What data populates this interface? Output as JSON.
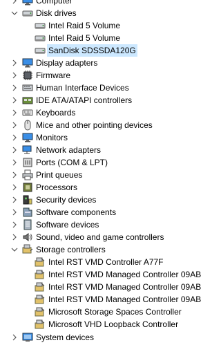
{
  "tree": {
    "computer": {
      "label": "Computer"
    },
    "disk_drives": {
      "label": "Disk drives",
      "children": [
        "Intel Raid 5 Volume",
        "Intel Raid 5 Volume",
        "SanDisk SDSSDA120G"
      ]
    },
    "categories_a": [
      {
        "label": "Display adapters",
        "icon": "monitor-icon"
      },
      {
        "label": "Firmware",
        "icon": "chip-icon"
      },
      {
        "label": "Human Interface Devices",
        "icon": "hid-icon"
      },
      {
        "label": "IDE ATA/ATAPI controllers",
        "icon": "ide-controller-icon"
      },
      {
        "label": "Keyboards",
        "icon": "keyboard-icon"
      },
      {
        "label": "Mice and other pointing devices",
        "icon": "mouse-icon"
      },
      {
        "label": "Monitors",
        "icon": "monitor-icon"
      },
      {
        "label": "Network adapters",
        "icon": "network-adapter-icon"
      },
      {
        "label": "Ports (COM & LPT)",
        "icon": "port-icon"
      },
      {
        "label": "Print queues",
        "icon": "printer-icon"
      },
      {
        "label": "Processors",
        "icon": "processor-icon"
      },
      {
        "label": "Security devices",
        "icon": "security-device-icon"
      },
      {
        "label": "Software components",
        "icon": "software-component-icon"
      },
      {
        "label": "Software devices",
        "icon": "software-device-icon"
      },
      {
        "label": "Sound, video and game controllers",
        "icon": "speaker-icon"
      }
    ],
    "storage_controllers": {
      "label": "Storage controllers",
      "children": [
        "Intel RST VMD Controller A77F",
        "Intel RST VMD Managed Controller 09AB",
        "Intel RST VMD Managed Controller 09AB",
        "Intel RST VMD Managed Controller 09AB",
        "Microsoft Storage Spaces Controller",
        "Microsoft VHD Loopback Controller"
      ]
    },
    "system_devices": {
      "label": "System devices"
    }
  },
  "colors": {
    "selection": "#cce8ff",
    "accent": "#1e73be"
  }
}
